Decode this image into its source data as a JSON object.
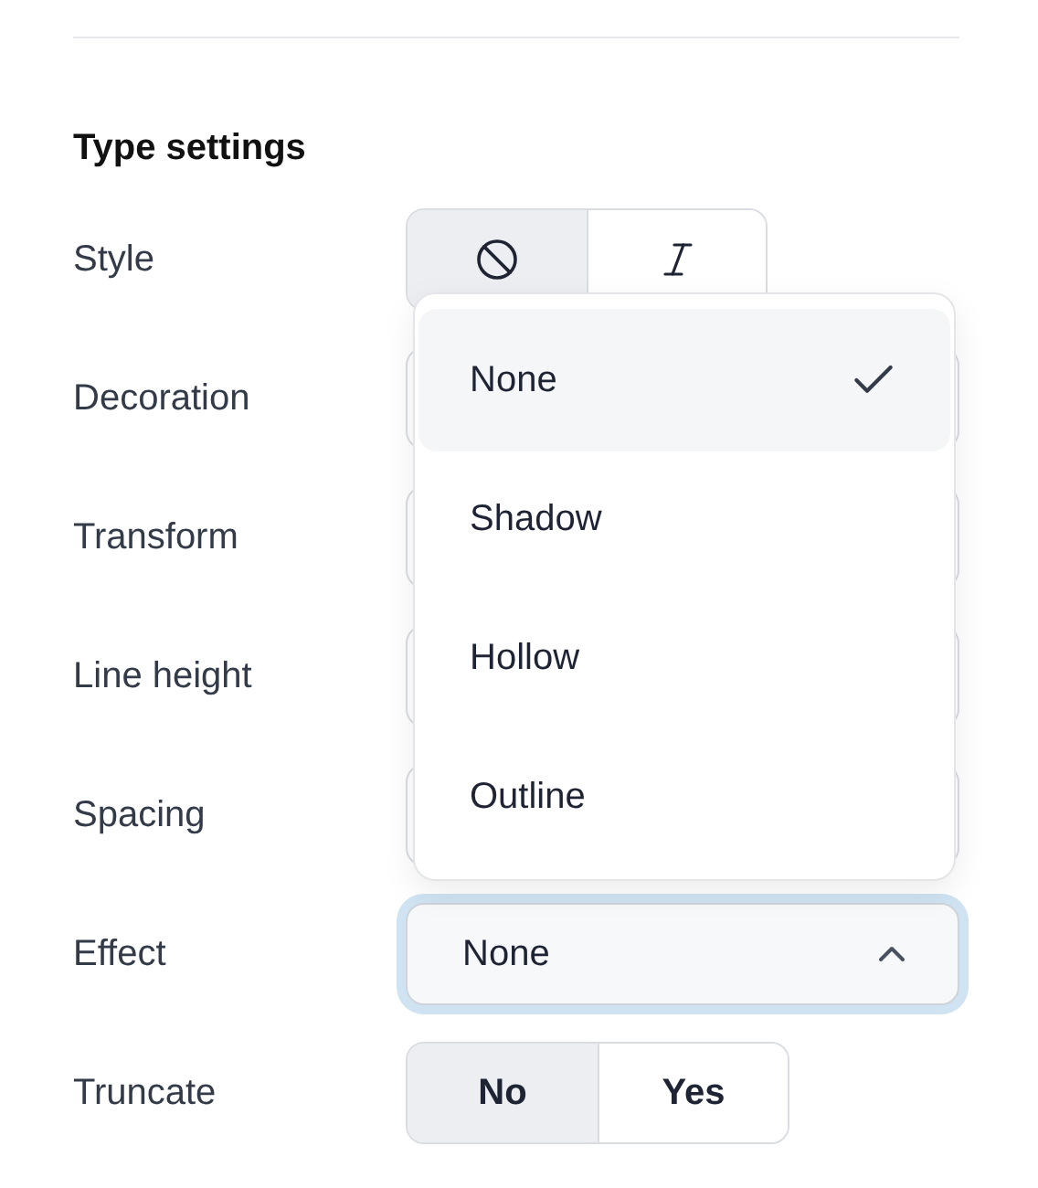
{
  "section": {
    "title": "Type settings"
  },
  "rows": [
    {
      "label": "Style",
      "kind": "segmented",
      "options": [
        {
          "kind": "ban",
          "selected": true
        },
        {
          "kind": "italic",
          "selected": false
        }
      ]
    },
    {
      "label": "Decoration",
      "kind": "covered"
    },
    {
      "label": "Transform",
      "kind": "covered"
    },
    {
      "label": "Line height",
      "kind": "covered"
    },
    {
      "label": "Spacing",
      "kind": "covered"
    },
    {
      "label": "Effect",
      "kind": "select",
      "value": "None",
      "expanded": true,
      "menu": [
        {
          "label": "None",
          "selected": true
        },
        {
          "label": "Shadow",
          "selected": false
        },
        {
          "label": "Hollow",
          "selected": false
        },
        {
          "label": "Outline",
          "selected": false
        }
      ]
    },
    {
      "label": "Truncate",
      "kind": "segmented",
      "options": [
        {
          "label": "No",
          "selected": true
        },
        {
          "label": "Yes",
          "selected": false
        }
      ]
    }
  ]
}
